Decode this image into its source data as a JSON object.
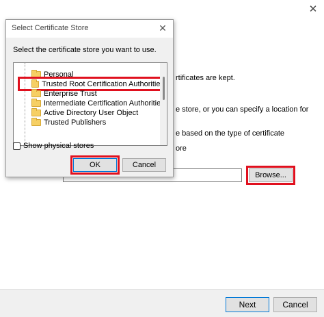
{
  "wizard": {
    "close_glyph": "✕",
    "body_lines": [
      "rtificates are kept.",
      "e store, or you can specify a location for",
      "e based on the type of certificate",
      "ore"
    ],
    "browse_label": "Browse...",
    "next_label": "Next",
    "cancel_label": "Cancel"
  },
  "dialog": {
    "title": "Select Certificate Store",
    "close_glyph": "✕",
    "instruction": "Select the certificate store you want to use.",
    "stores": [
      "Personal",
      "Trusted Root Certification Authorities",
      "Enterprise Trust",
      "Intermediate Certification Authorities",
      "Active Directory User Object",
      "Trusted Publishers"
    ],
    "show_physical_label": "Show physical stores",
    "show_physical_checked": false,
    "ok_label": "OK",
    "cancel_label": "Cancel"
  },
  "highlight_color": "#e0101e",
  "folder_icon": "folder-icon"
}
